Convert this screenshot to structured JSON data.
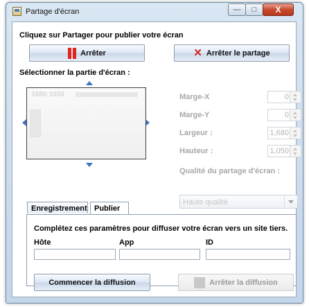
{
  "window": {
    "title": "Partage d'écran",
    "controls": {
      "minimize": "—",
      "maximize": "□",
      "close": "X"
    }
  },
  "main": {
    "instruction": "Cliquez sur Partager pour publier votre écran",
    "pause_button": {
      "label": "Arrêter",
      "icon": "pause-icon"
    },
    "stop_share_button": {
      "label": "Arrêter le partage",
      "icon": "close-icon"
    },
    "select_area_label": "Sélectionner la partie d'écran :",
    "preview": {
      "resolution_text": "1680:1050"
    }
  },
  "settings": {
    "margin_x": {
      "label": "Marge-X",
      "value": "0"
    },
    "margin_y": {
      "label": "Marge-Y",
      "value": "0"
    },
    "width": {
      "label": "Largeur :",
      "value": "1,680"
    },
    "height": {
      "label": "Hauteur :",
      "value": "1,050"
    },
    "quality": {
      "label": "Qualité du partage d'écran :",
      "selected": "Haute qualité"
    }
  },
  "tabs": [
    {
      "label": "Enregistrement",
      "active": false
    },
    {
      "label": "Publier",
      "active": true
    }
  ],
  "publish": {
    "description": "Complétez ces paramètres pour diffuser votre écran vers un site tiers.",
    "host_label": "Hôte",
    "app_label": "App",
    "id_label": "ID",
    "host_value": "",
    "app_value": "",
    "id_value": "",
    "start_button": "Commencer la diffusion",
    "stop_button": "Arrêter la diffusion"
  },
  "colors": {
    "accent_blue": "#3f6fc0",
    "stop_red": "#d32520",
    "window_frame": "#c4d6ea"
  }
}
